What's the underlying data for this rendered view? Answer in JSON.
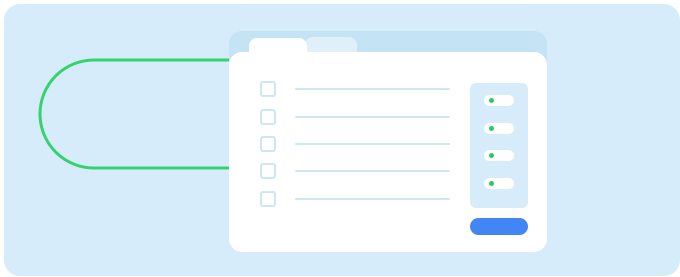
{
  "colors": {
    "background": "#d6ecfb",
    "window_header": "#c4e4f6",
    "window_body": "#ffffff",
    "accent_green": "#2fc860",
    "accent_blue": "#4285f4",
    "placeholder": "#cde6f6"
  },
  "window": {
    "tabs": [
      {
        "label": ""
      },
      {
        "label": ""
      }
    ],
    "items": [
      {
        "label": ""
      },
      {
        "label": ""
      },
      {
        "label": ""
      },
      {
        "label": ""
      },
      {
        "label": ""
      }
    ],
    "toggles": [
      {
        "state": "on"
      },
      {
        "state": "on"
      },
      {
        "state": "on"
      },
      {
        "state": "on"
      }
    ],
    "button": {
      "label": ""
    }
  },
  "icons": {
    "checkbox": "checkbox-icon",
    "toggle_indicator": "green-dot-icon",
    "connector": "green-loop-connector"
  }
}
